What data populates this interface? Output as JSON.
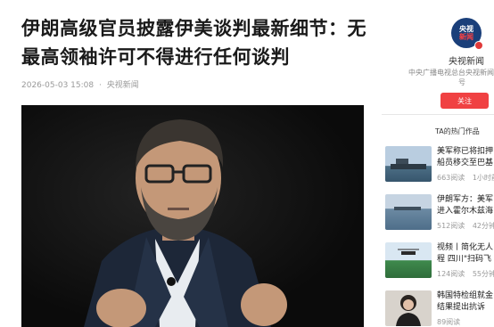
{
  "article": {
    "title": "伊朗高级官员披露伊美谈判最新细节：无最高领袖许可不得进行任何谈判",
    "timestamp": "2026-05-03 15:08",
    "separator": "·",
    "source": "央视新闻"
  },
  "sidebar": {
    "logo_line1": "央视",
    "logo_line2": "新闻",
    "channel_name": "央视新闻",
    "channel_desc_line1": "中央广播电视总台央视新闻",
    "channel_desc_line2": "号",
    "follow_label": "关注",
    "hot_title": "TA的热门作品",
    "items": [
      {
        "line1": "美军称已将扣押",
        "line2": "船员移交至巴基",
        "views": "663阅读",
        "time": "1小时前"
      },
      {
        "line1": "伊朗军方：美军",
        "line2": "进入霍尔木兹海",
        "views": "512阅读",
        "time": "42分钟"
      },
      {
        "line1": "视频丨简化无人",
        "line2": "程 四川\"扫码飞",
        "views": "124阅读",
        "time": "55分钟"
      },
      {
        "line1": "韩国特检组就金",
        "line2": "结果提出抗诉",
        "views": "89阅读",
        "time": ""
      }
    ]
  }
}
